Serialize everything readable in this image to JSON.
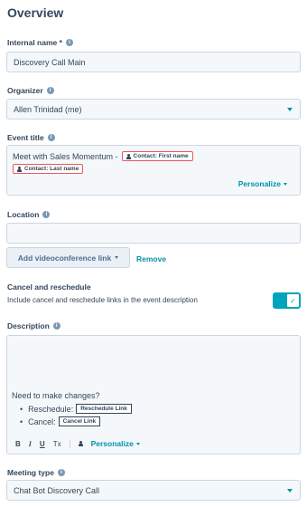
{
  "overview": {
    "title": "Overview"
  },
  "internal_name": {
    "label": "Internal name *",
    "value": "Discovery Call Main"
  },
  "organizer": {
    "label": "Organizer",
    "value": "Allen Trinidad (me)"
  },
  "event_title": {
    "label": "Event title",
    "text": "Meet with Sales Momentum -",
    "tokens": [
      "Contact: First name",
      "Contact: Last name"
    ],
    "personalize": "Personalize"
  },
  "location": {
    "label": "Location",
    "value": "",
    "videoconference_button": "Add videoconference link",
    "remove_link": "Remove"
  },
  "cancel_reschedule": {
    "label": "Cancel and reschedule",
    "description": "Include cancel and reschedule links in the event description",
    "enabled": true
  },
  "description": {
    "label": "Description",
    "heading": "Need to make changes?",
    "bullets": [
      {
        "label": "Reschedule:",
        "button": "Reschedule Link"
      },
      {
        "label": "Cancel:",
        "button": "Cancel Link"
      }
    ],
    "toolbar": {
      "bold": "B",
      "italic": "I",
      "underline": "U",
      "clear_format": "Tx",
      "personalize": "Personalize"
    }
  },
  "meeting_type": {
    "label": "Meeting type",
    "value": "Chat Bot Discovery Call"
  },
  "colors": {
    "accent": "#0091ae",
    "toggle_on": "#00a4bd",
    "token_border": "#f2545b",
    "text": "#33475b"
  }
}
